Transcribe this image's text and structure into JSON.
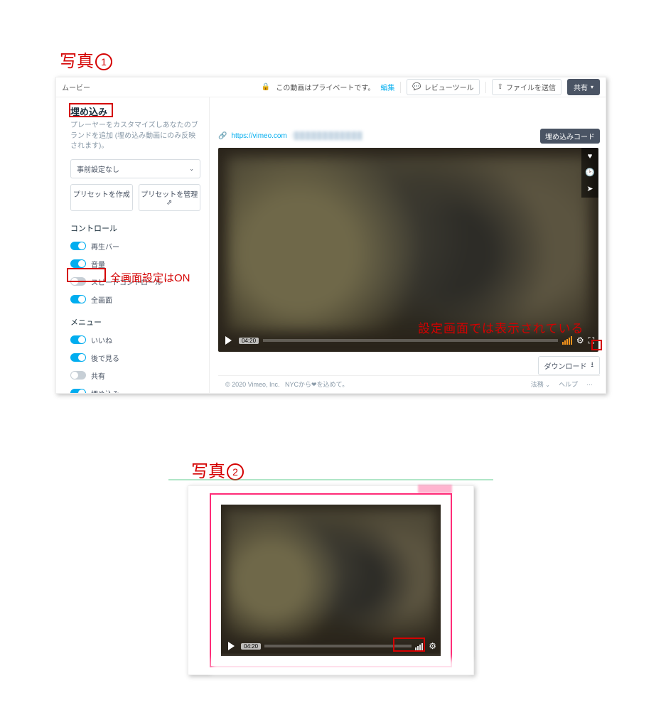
{
  "captions": {
    "photo1": "写真",
    "num1": "1",
    "photo2": "写真",
    "num2": "2"
  },
  "annotations": {
    "fullscreen_on": "全画面設定はON",
    "displayed_in_settings": "設定画面では表示されている"
  },
  "topbar": {
    "page_label": "ムービー",
    "privacy_text": "この動画はプライベートです。",
    "edit": "編集",
    "review_tool": "レビューツール",
    "send_file": "ファイルを送信",
    "share": "共有"
  },
  "sidebar": {
    "title": "埋め込み",
    "subtitle": "プレーヤーをカスタマイズしあなたのブランドを追加 (埋め込み動画にのみ反映されます)。",
    "preset_select": "事前設定なし",
    "create_preset": "プリセットを作成",
    "manage_preset": "プリセットを管理",
    "controls_title": "コントロール",
    "controls": {
      "playbar": {
        "label": "再生バー",
        "on": true
      },
      "volume": {
        "label": "音量",
        "on": true
      },
      "speed": {
        "label": "スピードコントロール",
        "on": false
      },
      "fullscreen": {
        "label": "全画面",
        "on": true
      }
    },
    "menu_title": "メニュー",
    "menu": {
      "like": {
        "label": "いいね",
        "on": true
      },
      "watch_later": {
        "label": "後で見る",
        "on": true
      },
      "share": {
        "label": "共有",
        "on": false
      },
      "embed": {
        "label": "埋め込み",
        "on": true
      }
    }
  },
  "main": {
    "url_prefix": "https://vimeo.com",
    "embed_code_btn": "埋め込みコード",
    "time": "04:20",
    "download": "ダウンロード"
  },
  "footer": {
    "copyright": "© 2020 Vimeo, Inc.",
    "made_in": "NYCから❤を込めて。",
    "legal": "法務",
    "help": "ヘルプ"
  },
  "player2_time": "04:20"
}
